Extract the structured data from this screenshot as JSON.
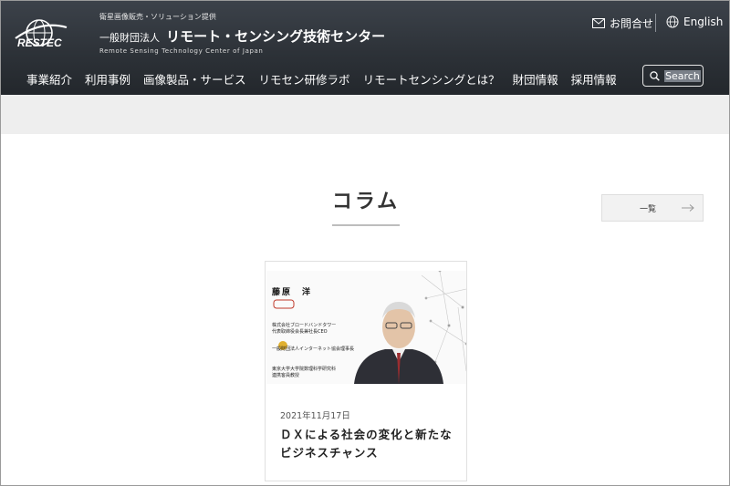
{
  "header": {
    "tagline": "衛星画像販売・ソリューション提供",
    "org_prefix": "一般財団法人",
    "org_name": "リモート・センシング技術センター",
    "org_en": "Remote Sensing Technology Center of Japan",
    "contact_label": "お問合せ",
    "english_label": "English",
    "search_label": "Search",
    "logo_text": "RESTEC"
  },
  "nav": {
    "items": [
      "事業紹介",
      "利用事例",
      "画像製品・サービス",
      "リモセン研修ラボ",
      "リモートセンシングとは？",
      "財団情報",
      "採用情報"
    ]
  },
  "section": {
    "title": "コラム",
    "list_button": "一覧"
  },
  "card": {
    "date": "2021年11月17日",
    "title": "ＤＸによる社会の変化と新たなビジネスチャンス",
    "thumb": {
      "name": "藤原　洋",
      "line1": "株式会社ブロードバンドタワー",
      "line2": "代表取締役会長兼社長CEO",
      "line3": "一般財団法人インターネット協会理事長",
      "line4": "東京大学大学院数理科学研究科",
      "line5": "連携客員教授"
    }
  },
  "colors": {
    "header_bg": "#2d3238",
    "band_bg": "#eeeeee"
  }
}
